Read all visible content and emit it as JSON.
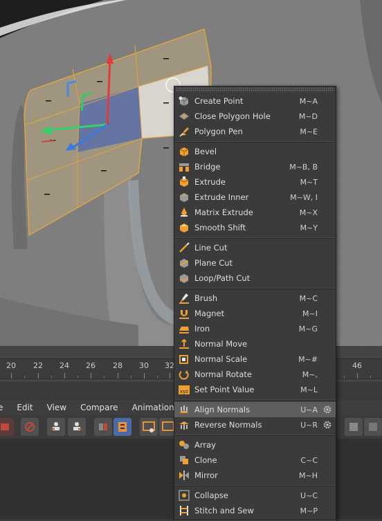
{
  "timeline": {
    "ticks": [
      {
        "label": "20"
      },
      {
        "label": "22"
      },
      {
        "label": "24"
      },
      {
        "label": "26"
      },
      {
        "label": "28"
      },
      {
        "label": "30"
      },
      {
        "label": "32"
      },
      {
        "label": "46"
      }
    ]
  },
  "menubar": {
    "items": [
      {
        "label": "e"
      },
      {
        "label": "Edit"
      },
      {
        "label": "View"
      },
      {
        "label": "Compare"
      },
      {
        "label": "Animation"
      }
    ]
  },
  "context_menu": {
    "sections": [
      {
        "items": [
          {
            "label": "Create Point",
            "shortcut": "M~A",
            "icon": "create-point-icon"
          },
          {
            "label": "Close Polygon Hole",
            "shortcut": "M~D",
            "icon": "close-polygon-hole-icon"
          },
          {
            "label": "Polygon Pen",
            "shortcut": "M~E",
            "icon": "polygon-pen-icon"
          }
        ]
      },
      {
        "items": [
          {
            "label": "Bevel",
            "shortcut": "",
            "icon": "bevel-icon"
          },
          {
            "label": "Bridge",
            "shortcut": "M~B, B",
            "icon": "bridge-icon"
          },
          {
            "label": "Extrude",
            "shortcut": "M~T",
            "icon": "extrude-icon"
          },
          {
            "label": "Extrude Inner",
            "shortcut": "M~W, I",
            "icon": "extrude-inner-icon"
          },
          {
            "label": "Matrix Extrude",
            "shortcut": "M~X",
            "icon": "matrix-extrude-icon"
          },
          {
            "label": "Smooth Shift",
            "shortcut": "M~Y",
            "icon": "smooth-shift-icon"
          }
        ]
      },
      {
        "items": [
          {
            "label": "Line Cut",
            "shortcut": "",
            "icon": "line-cut-icon"
          },
          {
            "label": "Plane Cut",
            "shortcut": "",
            "icon": "plane-cut-icon"
          },
          {
            "label": "Loop/Path Cut",
            "shortcut": "",
            "icon": "loop-path-cut-icon"
          }
        ]
      },
      {
        "items": [
          {
            "label": "Brush",
            "shortcut": "M~C",
            "icon": "brush-icon"
          },
          {
            "label": "Magnet",
            "shortcut": "M~I",
            "icon": "magnet-icon"
          },
          {
            "label": "Iron",
            "shortcut": "M~G",
            "icon": "iron-icon"
          },
          {
            "label": "Normal Move",
            "shortcut": "",
            "icon": "normal-move-icon"
          },
          {
            "label": "Normal Scale",
            "shortcut": "M~#",
            "icon": "normal-scale-icon"
          },
          {
            "label": "Normal Rotate",
            "shortcut": "M~,",
            "icon": "normal-rotate-icon"
          },
          {
            "label": "Set Point Value",
            "shortcut": "M~L",
            "icon": "set-point-value-icon"
          }
        ]
      },
      {
        "items": [
          {
            "label": "Align Normals",
            "shortcut": "U~A",
            "icon": "align-normals-icon",
            "highlighted": true,
            "gear": true
          },
          {
            "label": "Reverse Normals",
            "shortcut": "U~R",
            "icon": "reverse-normals-icon",
            "gear": true
          }
        ]
      },
      {
        "items": [
          {
            "label": "Array",
            "shortcut": "",
            "icon": "array-icon"
          },
          {
            "label": "Clone",
            "shortcut": "C~C",
            "icon": "clone-icon"
          },
          {
            "label": "Mirror",
            "shortcut": "M~H",
            "icon": "mirror-icon"
          }
        ]
      },
      {
        "items": [
          {
            "label": "Collapse",
            "shortcut": "U~C",
            "icon": "collapse-icon"
          },
          {
            "label": "Stitch and Sew",
            "shortcut": "M~P",
            "icon": "stitch-and-sew-icon"
          }
        ]
      }
    ]
  },
  "colors": {
    "accent_orange": "#f0a030",
    "selection_blue": "#4f6fb0",
    "menu_bg": "#3b3b3b",
    "menu_highlight": "#5e5e5e",
    "viewport_bg": "#7e7e7e"
  }
}
